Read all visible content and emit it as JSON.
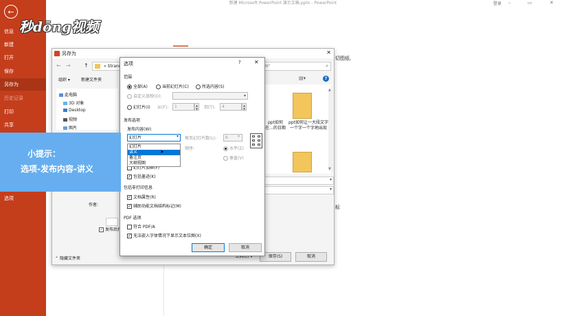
{
  "app": {
    "title": "新建 Microsoft PowerPoint 演示文稿.pptx - PowerPoint",
    "login": "登录",
    "watermark": "秒dōng视频"
  },
  "window_controls": {
    "minimize": "–",
    "restore": "▭",
    "close": "✕"
  },
  "backstage_nav": {
    "back_icon": "←",
    "items": [
      {
        "label": "信息"
      },
      {
        "label": "新建"
      },
      {
        "label": "打开"
      },
      {
        "label": "保存"
      },
      {
        "label": "另存为"
      },
      {
        "label": "历史记录"
      },
      {
        "label": "打印"
      },
      {
        "label": "共享"
      },
      {
        "label": "选项"
      }
    ]
  },
  "background": {
    "frag1": "切图纸,",
    "frag2": "标"
  },
  "save_as": {
    "title": "另存为",
    "close": "✕",
    "nav": {
      "back": "←",
      "forward": "→",
      "up": "↑",
      "refresh": "⟳"
    },
    "address": "« Strand",
    "search": "\"2018-09\"",
    "toolbar": {
      "organize": "组织 ▾",
      "new_folder": "新建文件夹"
    },
    "tree": [
      {
        "label": "此电脑"
      },
      {
        "label": "3D 对象"
      },
      {
        "label": "Desktop"
      },
      {
        "label": "视频"
      },
      {
        "label": "图片"
      }
    ],
    "files": [
      {
        "name": "ppt如何在...的日期"
      },
      {
        "name": "ppt如何让一大段文字一个字一个字地出现"
      }
    ],
    "author_label": "作者:",
    "publish_after_label": "发布后打",
    "hide_folders": "隐藏文件夹",
    "tools_button": "工具(L) ▾",
    "save_button": "保存(S)",
    "cancel_button": "取消"
  },
  "options_dialog": {
    "title": "选项",
    "help": "?",
    "close": "✕",
    "range": {
      "section": "范围",
      "all": "全部(A)",
      "current": "当前幻灯片(C)",
      "selection": "所选内容(S)",
      "custom_show": "自定义放映(O):",
      "slides": "幻灯片(I)",
      "from": "从(F):",
      "from_value": "1",
      "to": "到(T):",
      "to_value": "4"
    },
    "publish": {
      "section": "发布选项",
      "what_label": "发布内容(W):",
      "what_value": "幻灯片",
      "list_options": [
        "幻灯片",
        "讲义",
        "备注页",
        "大纲视图"
      ],
      "selected_index": 1,
      "per_page_label": "每页幻灯片数(L):",
      "per_page_value": "6",
      "order_label": "顺序:",
      "horizontal": "水平(Z)",
      "vertical": "垂直(V)",
      "frame_slides": "幻灯片加框(F)",
      "hidden_slides": "包括隐藏幻灯片(H)",
      "comments": "包括墨迹(K)"
    },
    "non_print": {
      "section": "包括非打印信息",
      "doc_props": "文档属性(R)",
      "struct_tags": "辅助功能文档结构标记(M)"
    },
    "pdf": {
      "section": "PDF 选项",
      "pdfa": "符合 PDF/A",
      "bitmap": "无法嵌入字体情况下显示文本位图(X)"
    },
    "ok": "确定",
    "cancel": "取消"
  },
  "tip": {
    "title": "小提示：",
    "text": "选项-发布内容-讲义"
  }
}
